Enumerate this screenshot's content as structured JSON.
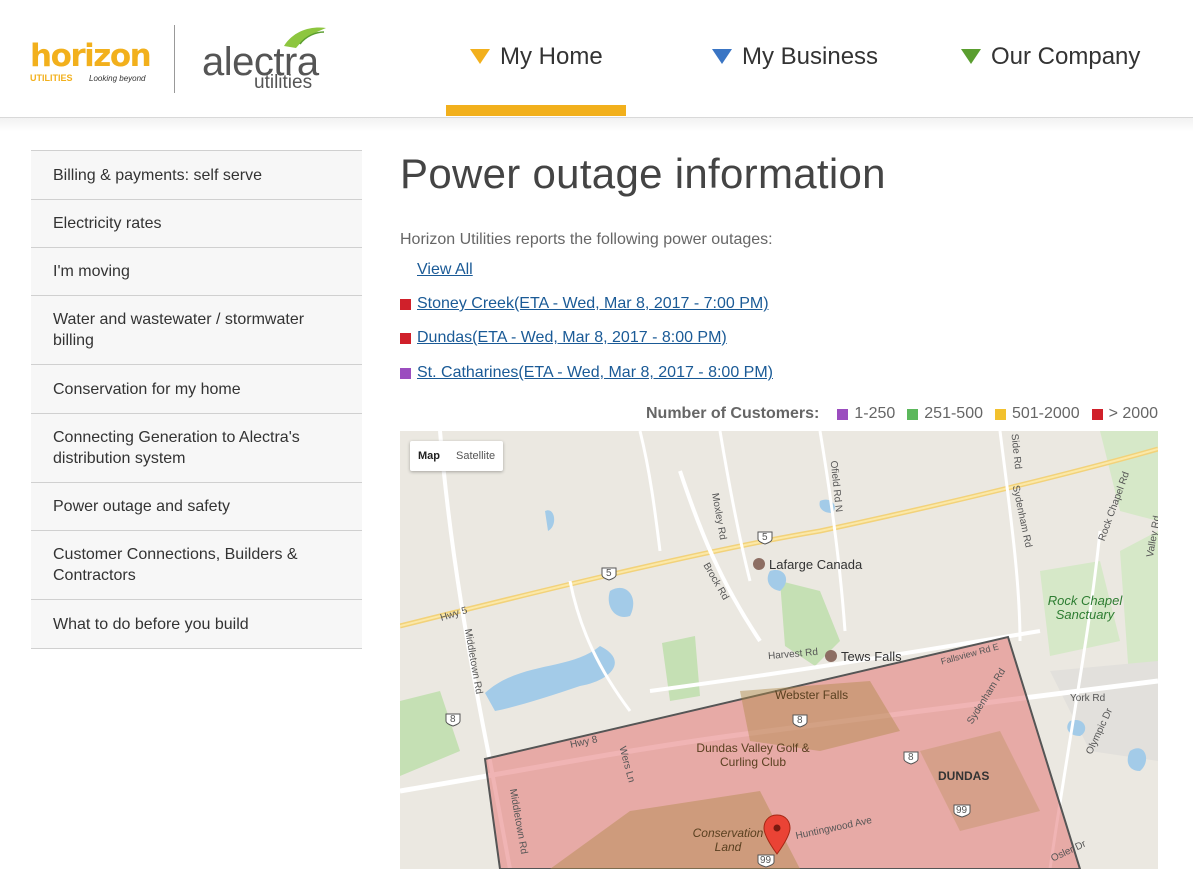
{
  "header": {
    "horizon_logo_text": "horizon",
    "horizon_logo_sub": "UTILITIES",
    "horizon_logo_tagline": "Looking beyond",
    "alectra_logo_text": "alectra",
    "alectra_logo_sub": "utilities",
    "nav": [
      {
        "label": "My Home",
        "color": "#f2b01c",
        "active": true
      },
      {
        "label": "My Business",
        "color": "#3a75c4",
        "active": false
      },
      {
        "label": "Our Company",
        "color": "#5a9e2f",
        "active": false
      }
    ]
  },
  "sidebar": {
    "items": [
      {
        "label": "Billing & payments: self serve"
      },
      {
        "label": "Electricity rates"
      },
      {
        "label": "I'm moving"
      },
      {
        "label": "Water and wastewater / stormwater billing"
      },
      {
        "label": "Conservation for my home"
      },
      {
        "label": "Connecting Generation to Alectra's distribution system"
      },
      {
        "label": "Power outage and safety"
      },
      {
        "label": "Customer Connections, Builders & Contractors"
      },
      {
        "label": "What to do before you build"
      }
    ]
  },
  "main": {
    "title": "Power outage information",
    "intro": "Horizon Utilities reports the following power outages:",
    "view_all": "View All",
    "outages": [
      {
        "label": "Stoney Creek(ETA - Wed, Mar 8, 2017 - 7:00 PM)",
        "color": "#d0202a"
      },
      {
        "label": "Dundas(ETA - Wed, Mar 8, 2017 - 8:00 PM)",
        "color": "#d0202a"
      },
      {
        "label": "St. Catharines(ETA - Wed, Mar 8, 2017 - 8:00 PM)",
        "color": "#9b4dbf"
      }
    ],
    "legend": {
      "label": "Number of Customers:",
      "items": [
        {
          "label": "1-250",
          "color": "#9b4dbf"
        },
        {
          "label": "251-500",
          "color": "#5cb85c"
        },
        {
          "label": "501-2000",
          "color": "#f2c12e"
        },
        {
          "label": "> 2000",
          "color": "#d0202a"
        }
      ]
    }
  },
  "map": {
    "toggle_map": "Map",
    "toggle_satellite": "Satellite",
    "places": {
      "lafarge": "Lafarge Canada",
      "tews_falls": "Tews Falls",
      "webster_falls": "Webster Falls",
      "golf": "Dundas Valley Golf & Curling Club",
      "dundas": "DUNDAS",
      "conservation": "Conservation Land",
      "rock_chapel": "Rock Chapel Sanctuary"
    },
    "roads": {
      "hwy5": "Hwy 5",
      "hwy8": "Hwy 8",
      "middletown": "Middletown Rd",
      "middletown2": "Middletown Rd",
      "brock": "Brock Rd",
      "moxley": "Moxley Rd",
      "ofield": "Ofield Rd N",
      "side": "Side Rd",
      "sydenham": "Sydenham Rd",
      "sydenham2": "Sydenham Rd",
      "rock_chapel_rd": "Rock Chapel Rd",
      "valley": "Valley Rd",
      "harvest": "Harvest Rd",
      "fallsview": "Fallsview Rd E",
      "york": "York Rd",
      "olympic": "Olympic Dr",
      "wers": "Wers Ln",
      "huntingwood": "Huntingwood Ave",
      "osler": "Osler Dr"
    },
    "shields": [
      "5",
      "5",
      "8",
      "8",
      "8",
      "99",
      "99"
    ]
  }
}
